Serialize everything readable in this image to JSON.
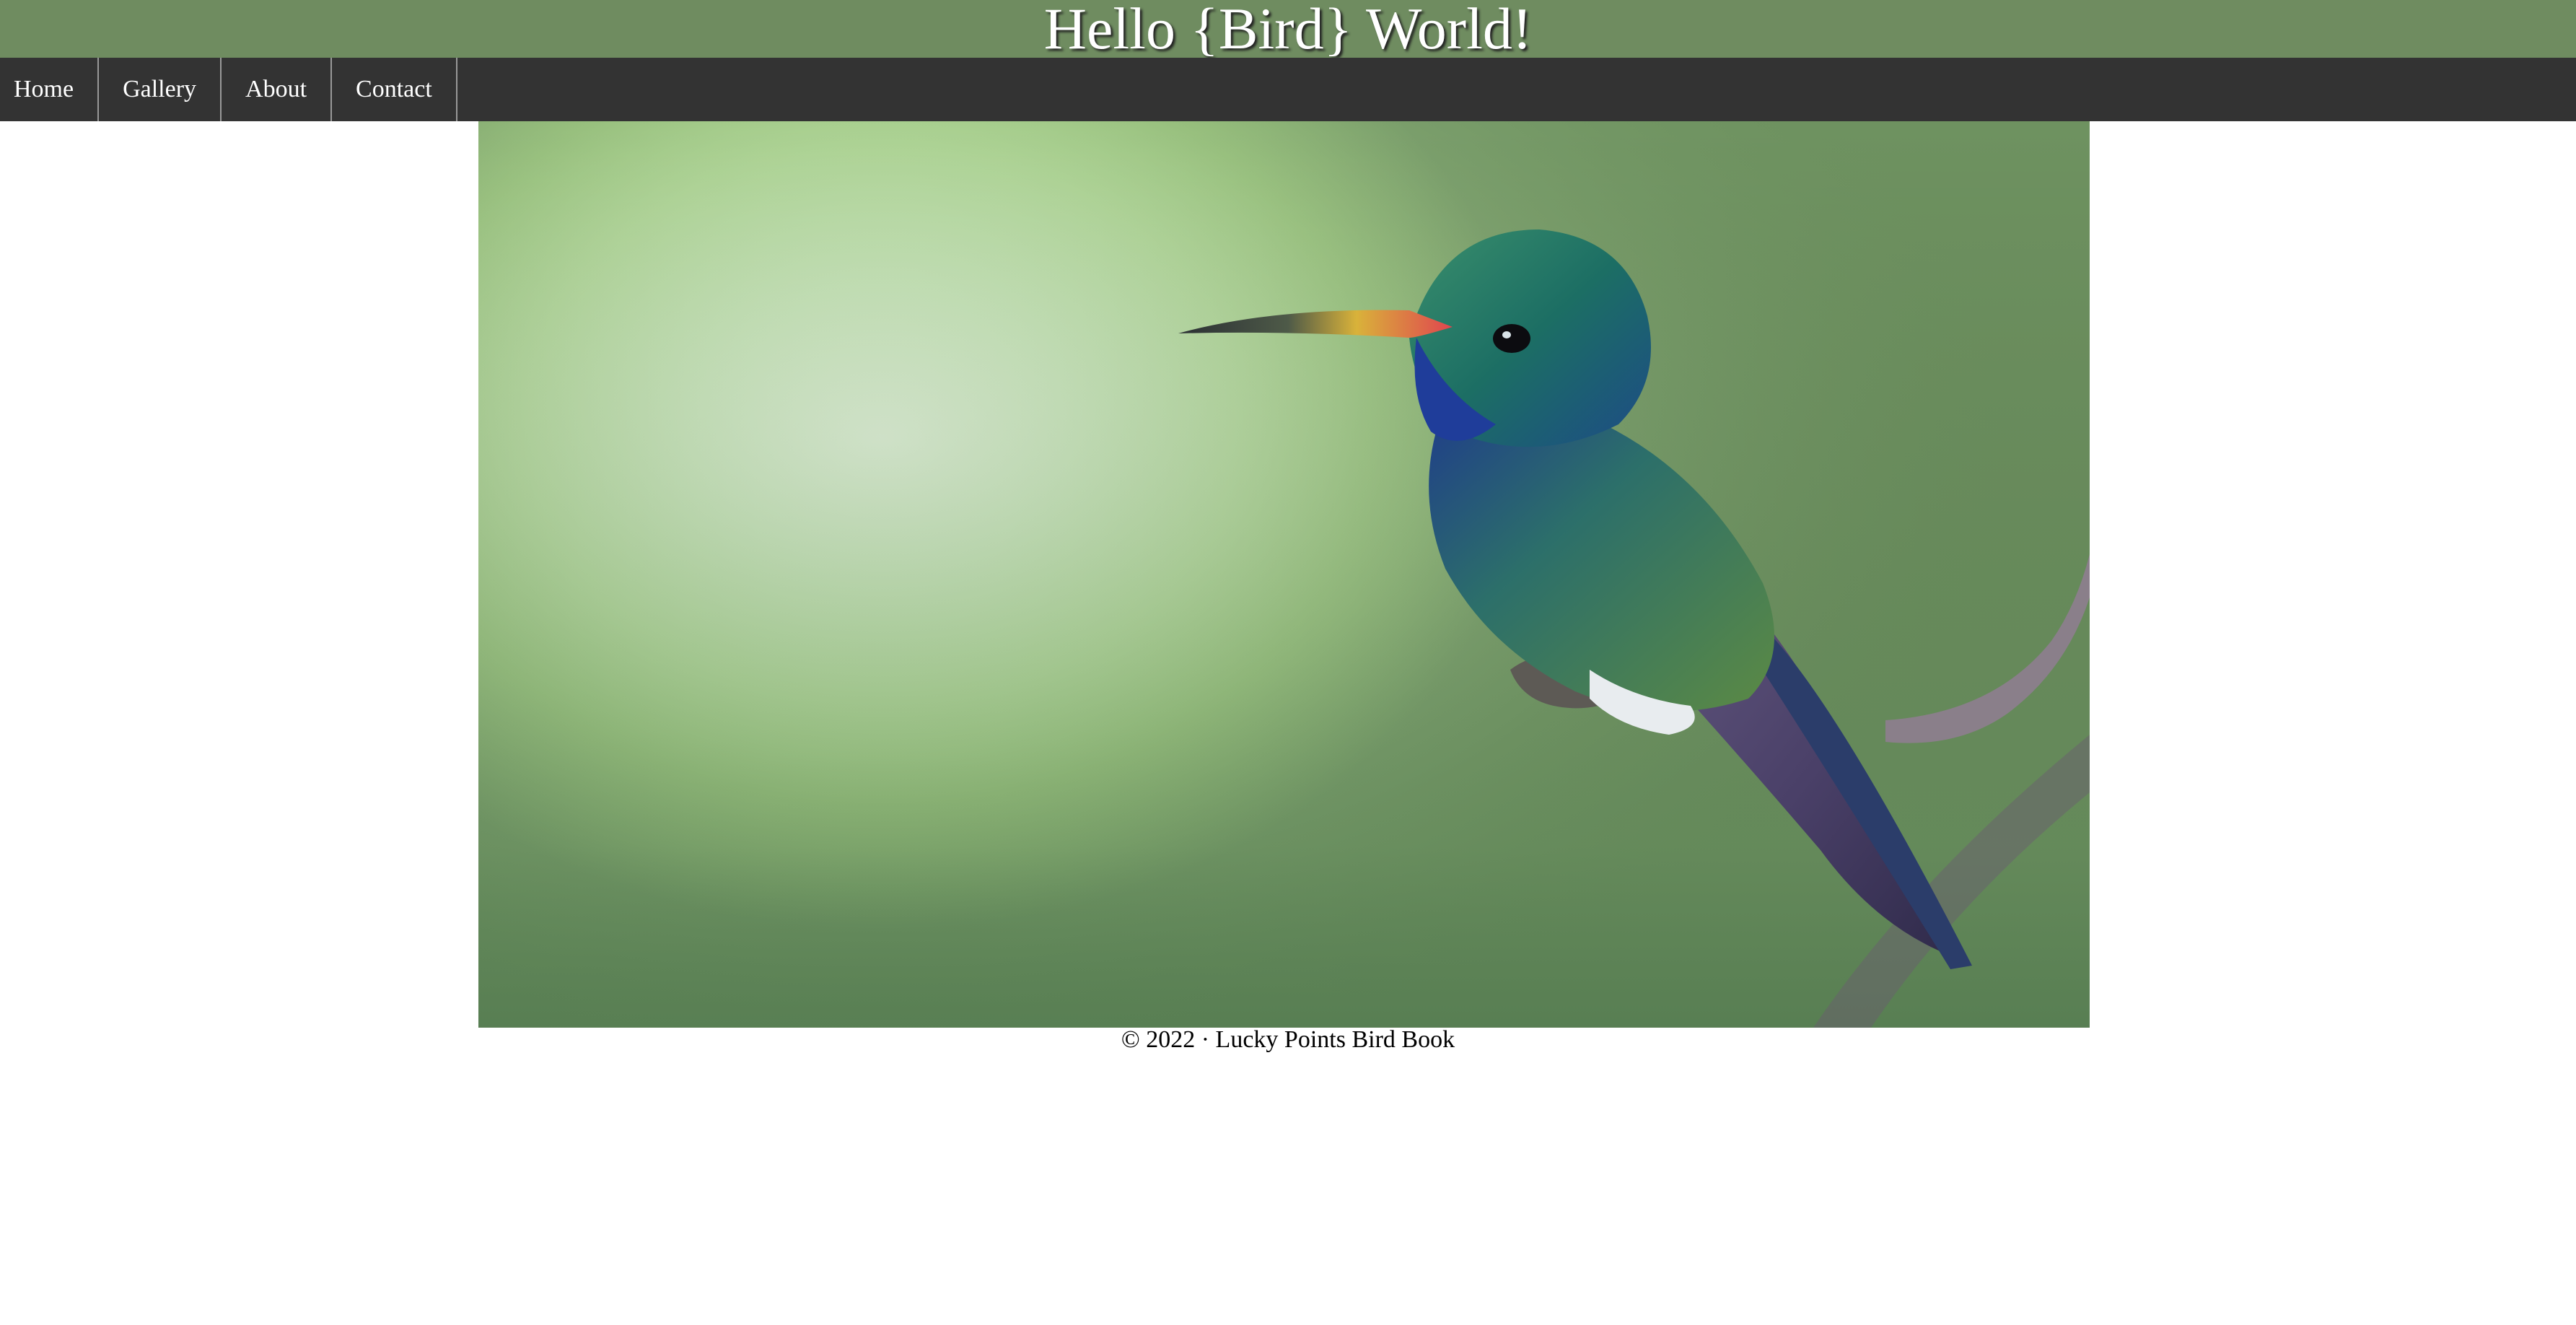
{
  "header": {
    "title": "Hello {Bird} World!"
  },
  "nav": {
    "items": [
      {
        "label": "Home"
      },
      {
        "label": "Gallery"
      },
      {
        "label": "About"
      },
      {
        "label": "Contact"
      }
    ]
  },
  "hero": {
    "icon": "hummingbird-photo"
  },
  "footer": {
    "text": "© 2022 · Lucky Points Bird Book"
  },
  "colors": {
    "header_bg": "#6f8c60",
    "nav_bg": "#333333",
    "text_light": "#ffffff"
  }
}
